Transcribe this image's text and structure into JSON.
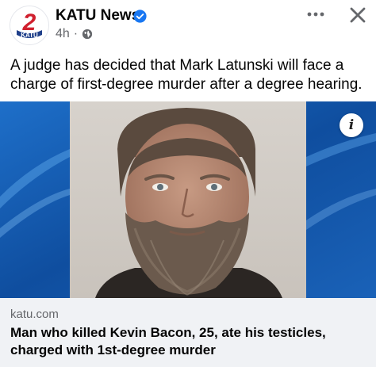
{
  "post": {
    "page_name": "KATU News",
    "logo_number": "2",
    "logo_text": "KATU",
    "timestamp": "4h",
    "separator": "·",
    "audience_icon": "globe-icon",
    "verified_icon": "verified-badge-icon",
    "caption": "A judge has decided that Mark Latunski will face a charge of first-degree murder after a degree hearing.",
    "info_label": "i"
  },
  "link_preview": {
    "domain": "katu.com",
    "title": "Man who killed Kevin Bacon, 25, ate his testicles, charged with 1st-degree murder"
  },
  "colors": {
    "brand_red": "#d0202e",
    "verified_blue": "#1877f2",
    "secondary_text": "#65676b",
    "footer_bg": "#f0f2f5",
    "image_blue": "#1a5fb4"
  }
}
